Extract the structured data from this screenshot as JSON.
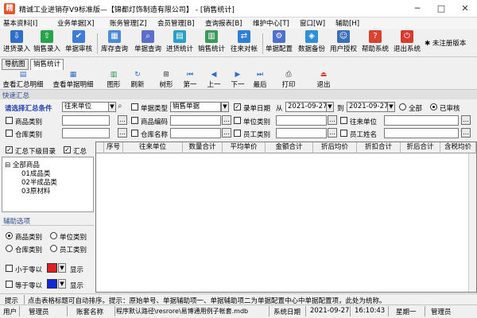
{
  "window": {
    "title": "精诚工业进销存V9标准版—【锦都灯饰制造有限公司】 - [销售统计]",
    "app_icon_glyph": "精",
    "minimize": "─",
    "maximize": "□",
    "close": "✕"
  },
  "menu": [
    "基本资料[I]",
    "业务单据[X]",
    "账务管理[Z]",
    "会员管理[B]",
    "查询报表[B]",
    "维护中心[T]",
    "窗口[W]",
    "辅助[H]"
  ],
  "toolbar": {
    "buttons": [
      {
        "label": "进货录入",
        "icon": "stock-in-icon",
        "color": "#2f6fc9"
      },
      {
        "label": "销售录入",
        "icon": "sales-entry-icon",
        "color": "#27a34a"
      },
      {
        "label": "单据审核",
        "icon": "audit-icon",
        "color": "#3b7dd8"
      },
      {
        "label": "库存查询",
        "icon": "inventory-icon",
        "color": "#4a8ad8"
      },
      {
        "label": "单据查询",
        "icon": "doc-search-icon",
        "color": "#5a6fc9"
      },
      {
        "label": "进货统计",
        "icon": "purchase-stats-icon",
        "color": "#2aa0c9"
      },
      {
        "label": "销售统计",
        "icon": "sales-stats-icon",
        "color": "#3b9a5a"
      },
      {
        "label": "往来对帐",
        "icon": "reconcile-icon",
        "color": "#2f7fd9"
      },
      {
        "label": "单据配置",
        "icon": "doc-config-icon",
        "color": "#4f6fcf"
      },
      {
        "label": "数据备份",
        "icon": "backup-icon",
        "color": "#2f8fd9"
      },
      {
        "label": "用户授权",
        "icon": "user-auth-icon",
        "color": "#3a6fb9"
      },
      {
        "label": "帮助系统",
        "icon": "help-icon",
        "color": "#d9422f"
      },
      {
        "label": "退出系统",
        "icon": "exit-icon",
        "color": "#d93a2f"
      }
    ],
    "unregistered": "未注册版本",
    "unregistered_icon_color": "#333333"
  },
  "tabs": [
    "导航图",
    "销售统计"
  ],
  "toolbar2": {
    "buttons": [
      {
        "label": "查看汇总明细",
        "icon": "summary-detail-icon"
      },
      {
        "label": "查看单据明细",
        "icon": "doc-detail-icon"
      },
      {
        "label": "图形",
        "icon": "chart-icon"
      },
      {
        "label": "刷新",
        "icon": "refresh-icon"
      },
      {
        "label": "树形",
        "icon": "tree-icon"
      },
      {
        "label": "第一",
        "icon": "first-icon"
      },
      {
        "label": "上一",
        "icon": "prev-icon"
      },
      {
        "label": "下一",
        "icon": "next-icon"
      },
      {
        "label": "最后",
        "icon": "last-icon"
      },
      {
        "label": "打印",
        "icon": "print-icon"
      },
      {
        "label": "退出",
        "icon": "exit-icon"
      }
    ]
  },
  "quick_summary_title": "快速汇总",
  "filters": {
    "summary_condition_label": "请选择汇总条件",
    "summary_condition_value": "往来单位",
    "doc_type_label": "单据类型",
    "doc_type_value": "销售单据",
    "date_label": "录单日期",
    "from_label": "从",
    "date_from": "2021-09-27",
    "to_label": "到",
    "date_to": "2021-09-27",
    "status_all": "全部",
    "status_audited": "已审核",
    "product_category": "商品类别",
    "product_code": "商品编码",
    "unit_category": "单位类别",
    "partner_unit": "往来单位",
    "warehouse_category": "仓库类别",
    "warehouse_name": "仓库名称",
    "staff_category": "员工类别",
    "staff_name": "员工姓名"
  },
  "left_panel": {
    "summary_subdirs": "汇总下级目录",
    "summary": "汇总",
    "tree": [
      "全部商品",
      "01成品类",
      "02半成品类",
      "03原材料"
    ],
    "aux_title": "辅助选项",
    "radio_options": [
      "商品类别",
      "单位类别",
      "仓库类别",
      "员工类别"
    ],
    "less_than_zero": "小于零以",
    "equal_zero": "等于零以",
    "show": "显示",
    "less_color": "#e02020",
    "equal_color": "#1028d8"
  },
  "grid": {
    "columns": [
      "序号",
      "往来单位",
      "数量合计",
      "平均单价",
      "金额合计",
      "折后均价",
      "折扣合计",
      "折后合计",
      "含税均价"
    ]
  },
  "status": {
    "hint_label": "提示",
    "hint_text": "点击表格标题可自动排序。提示：原始单号、单据辅助项一、单据辅助项二为单据配置中心中单据配置项，此处为统称。",
    "bottom": [
      "用户",
      "管理员",
      "账套名称",
      "程序默认路径\\resrore\\易博通用例子帐套.mdb",
      "系统日期",
      "2021-09-27",
      "16:10:43",
      "星期一",
      "管理员"
    ]
  }
}
